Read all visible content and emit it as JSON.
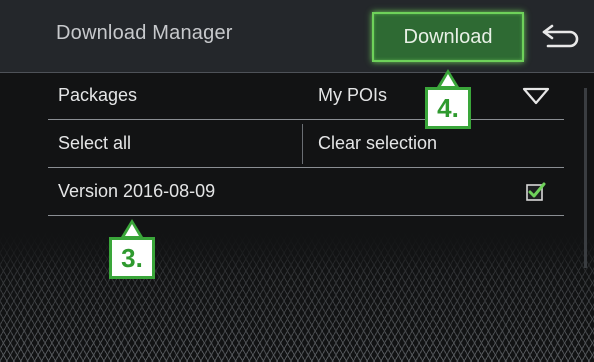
{
  "header": {
    "title": "Download Manager",
    "download_label": "Download",
    "back_icon": "back-arrow-icon"
  },
  "rows": {
    "packages_label": "Packages",
    "packages_value": "My POIs",
    "select_all_label": "Select all",
    "clear_selection_label": "Clear selection",
    "version_label": "Version 2016-08-09",
    "version_checked": true
  },
  "callouts": {
    "step4": "4.",
    "step3": "3."
  },
  "colors": {
    "accent_green": "#6ed15a",
    "button_fill": "#2e6a33",
    "callout_border": "#3aa63a"
  }
}
